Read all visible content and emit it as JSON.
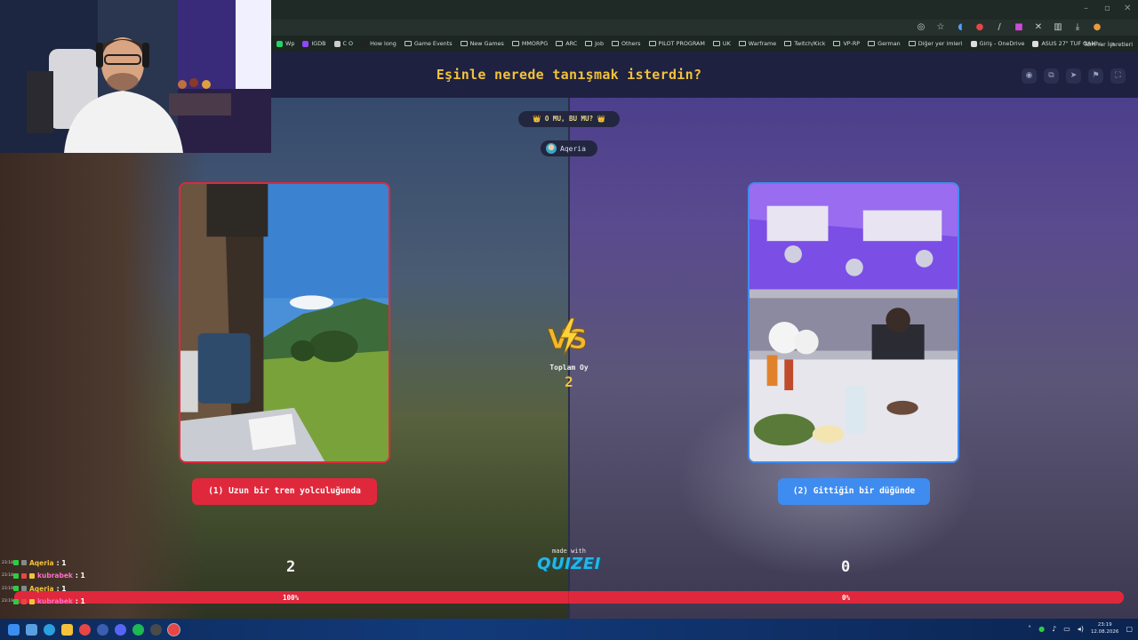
{
  "browser": {
    "window_controls": [
      "–",
      "▫",
      "✕"
    ],
    "bookmarks": [
      {
        "label": "Wp",
        "icon": "whatsapp-icon",
        "color": "#25d366"
      },
      {
        "label": "IGDB",
        "icon": "igdb-icon",
        "color": "#9147ff"
      },
      {
        "label": "C O",
        "icon": "page-icon",
        "color": "#cccccc"
      },
      {
        "label": "How long",
        "icon": "page-icon",
        "color": "#222222"
      },
      {
        "label": "Game Events",
        "icon": "folder-icon"
      },
      {
        "label": "New Games",
        "icon": "folder-icon"
      },
      {
        "label": "MMORPG",
        "icon": "folder-icon"
      },
      {
        "label": "ARC",
        "icon": "folder-icon"
      },
      {
        "label": "Job",
        "icon": "folder-icon"
      },
      {
        "label": "Others",
        "icon": "folder-icon"
      },
      {
        "label": "PILOT PROGRAM",
        "icon": "folder-icon"
      },
      {
        "label": "UK",
        "icon": "folder-icon"
      },
      {
        "label": "Warframe",
        "icon": "folder-icon"
      },
      {
        "label": "Twitch/Kick",
        "icon": "folder-icon"
      },
      {
        "label": "VP-RP",
        "icon": "folder-icon"
      },
      {
        "label": "German",
        "icon": "folder-icon"
      },
      {
        "label": "Diğer yer imleri",
        "icon": "folder-icon"
      },
      {
        "label": "Giriş - OneDrive",
        "icon": "globe-icon",
        "color": "#dddddd"
      },
      {
        "label": "ASUS 27\" TUF GAMI...",
        "icon": "globe-icon",
        "color": "#dddddd"
      }
    ],
    "more_bookmarks": "»",
    "all_bookmarks": "Tüm Yer İşaretleri"
  },
  "quiz": {
    "question": "Eşinle nerede tanışmak isterdin?",
    "mode": "👑 O MU, BU MU? 👑",
    "username": "Aqeria",
    "total_votes_label": "Toplam Oy",
    "total_votes": "2",
    "options": [
      {
        "label": "(1) Uzun bir tren yolculuğunda",
        "votes": "2",
        "percent_label": "100%",
        "percent": 100,
        "color": "#e0283c"
      },
      {
        "label": "(2) Gittiğin bir düğünde",
        "votes": "0",
        "percent_label": "0%",
        "percent": 0,
        "color": "#3f8cf0"
      }
    ],
    "made_with": "made with",
    "brand": "QUIZEI"
  },
  "header_icons": [
    "eye-icon",
    "copy-icon",
    "send-icon",
    "flag-icon",
    "fullscreen-icon"
  ],
  "chat": [
    {
      "time": "23:18",
      "name": "Aqeria",
      "message": ": 1",
      "name_color": "#f2c23a"
    },
    {
      "time": "23:18",
      "name": "kubrabek",
      "message": ": 1",
      "name_color": "#ff6ec7"
    },
    {
      "time": "23:19",
      "name": "Aqeria",
      "message": ": 1",
      "name_color": "#f2c23a"
    },
    {
      "time": "23:19",
      "name": "kubrabek",
      "message": ": 1",
      "name_color": "#ff6ec7"
    }
  ],
  "taskbar": {
    "time": "23:19",
    "date": "12.08.2026"
  }
}
